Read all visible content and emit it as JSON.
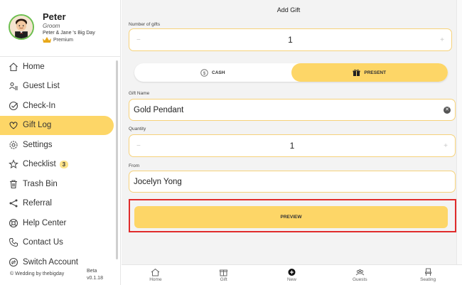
{
  "profile": {
    "name": "Peter",
    "role": "Groom",
    "event": "Peter & Jane 's Big Day",
    "plan": "Premium"
  },
  "nav": {
    "items": [
      {
        "label": "Home",
        "icon": "home-icon"
      },
      {
        "label": "Guest List",
        "icon": "guests-icon"
      },
      {
        "label": "Check-In",
        "icon": "checkin-icon"
      },
      {
        "label": "Gift Log",
        "icon": "heart-icon",
        "active": true
      },
      {
        "label": "Settings",
        "icon": "gear-icon"
      },
      {
        "label": "Checklist",
        "icon": "star-icon",
        "badge": "3"
      },
      {
        "label": "Trash Bin",
        "icon": "trash-icon"
      },
      {
        "label": "Referral",
        "icon": "share-icon"
      },
      {
        "label": "Help Center",
        "icon": "lifebuoy-icon"
      },
      {
        "label": "Contact Us",
        "icon": "phone-icon"
      },
      {
        "label": "Switch Account",
        "icon": "switch-icon"
      }
    ]
  },
  "footer": {
    "copyright": "© Wedding by thebigday",
    "beta": "Beta",
    "version": "v0.1.18"
  },
  "form": {
    "title": "Add Gift",
    "num_gifts_label": "Number of gifts",
    "num_gifts_value": "1",
    "type_cash": "CASH",
    "type_present": "PRESENT",
    "selected_type": "PRESENT",
    "gift_name_label": "Gift Name",
    "gift_name_value": "Gold Pendant",
    "quantity_label": "Quantity",
    "quantity_value": "1",
    "from_label": "From",
    "from_value": "Jocelyn Yong",
    "preview_label": "PREVIEW",
    "minus": "−",
    "plus": "+"
  },
  "tabbar": {
    "tabs": [
      {
        "label": "Home"
      },
      {
        "label": "Gift"
      },
      {
        "label": "New"
      },
      {
        "label": "Guests"
      },
      {
        "label": "Seating"
      }
    ]
  },
  "colors": {
    "accent": "#fdd667",
    "field_border": "#f6d27a",
    "highlight_box": "#e02c2c"
  }
}
